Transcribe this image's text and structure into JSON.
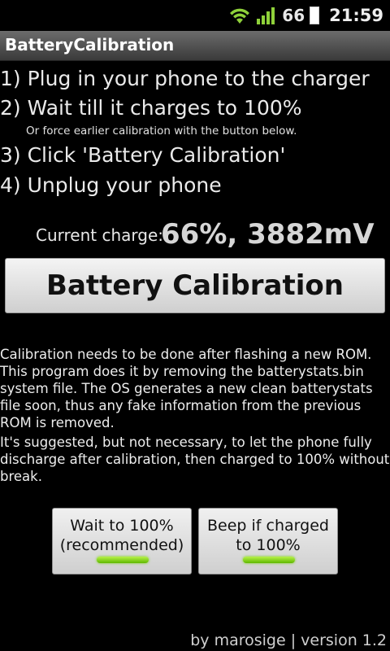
{
  "status_bar": {
    "battery_percent": "66",
    "time": "21:59",
    "icons": [
      "wifi-icon",
      "signal-icon",
      "battery-icon"
    ]
  },
  "app": {
    "title": "BatteryCalibration"
  },
  "steps": [
    "1) Plug in your phone to the charger",
    "2) Wait till it charges to 100%",
    "3) Click 'Battery Calibration'",
    "4) Unplug your phone"
  ],
  "step_note": "Or force earlier calibration with the button below.",
  "charge": {
    "label": "Current charge:",
    "value": "66%, 3882mV"
  },
  "main_button": {
    "label": "Battery Calibration"
  },
  "description": [
    "Calibration needs to be done after flashing a new ROM.\nThis program does it by removing the batterystats.bin\nsystem file. The OS generates a new clean batterystats\nfile soon, thus any fake information from the previous\nROM is removed.",
    "It's suggested, but not necessary, to let the phone fully\ndischarge after calibration, then charged to 100% without\nbreak."
  ],
  "toggles": [
    {
      "label": "Wait to 100%\n(recommended)",
      "on": true
    },
    {
      "label": "Beep if charged\nto 100%",
      "on": true
    }
  ],
  "footer": "by marosige | version 1.2",
  "colors": {
    "indicator_on": "#7cd21a",
    "background": "#000000"
  }
}
